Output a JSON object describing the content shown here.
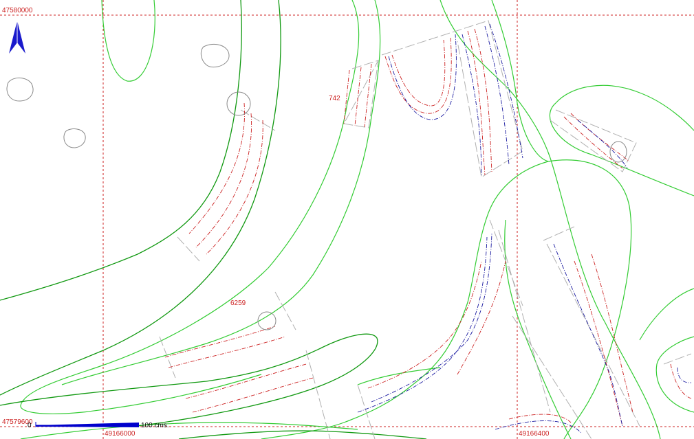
{
  "map": {
    "grid_labels": {
      "top_northing": "47580000",
      "bottom_northing": "47579600",
      "left_easting": "49166000",
      "right_easting": "49166400"
    },
    "feature_labels": {
      "feature_a": "742",
      "feature_b": "6259"
    },
    "scale_bar": {
      "start": "0",
      "end": "100 cms."
    },
    "north_arrow": "north-arrow-icon",
    "colors": {
      "grid": "#cc2222",
      "label": "#cc2222",
      "contour_light": "#33cc33",
      "contour_dark": "#119911",
      "section_red": "#cc2222",
      "section_blue": "#1a1aa0",
      "outline_gray": "#b0b0b0",
      "stone_gray": "#888888",
      "arrow": "#1a1acc",
      "scale": "#0000cc"
    }
  }
}
